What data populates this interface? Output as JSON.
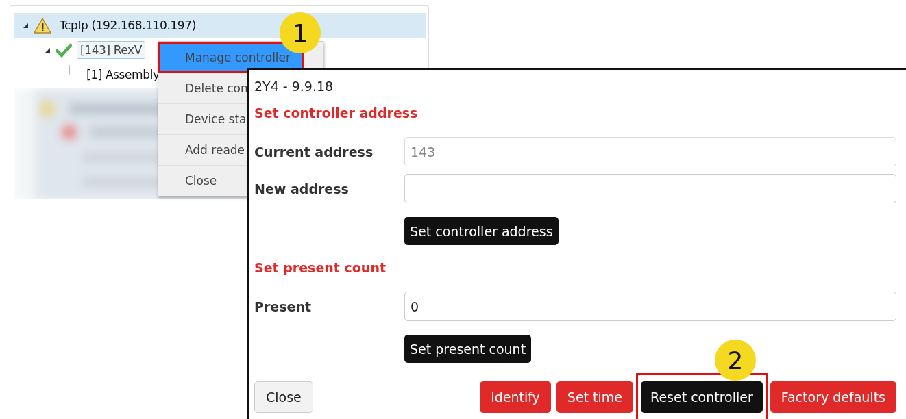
{
  "tree": {
    "items": [
      {
        "label": "TcpIp (192.168.110.197)",
        "kind": "warning",
        "expanded": true,
        "selected": true,
        "focused": false,
        "children": [
          {
            "label": "[143] RexV",
            "kind": "ok",
            "expanded": true,
            "selected": false,
            "focused": true,
            "children": [
              {
                "label": "[1] Assembly",
                "selected": false,
                "focused": false
              }
            ]
          }
        ]
      }
    ]
  },
  "context_menu": {
    "items": [
      {
        "label": "Manage controller",
        "highlighted": true,
        "callout": true
      },
      {
        "label": "Delete con",
        "highlighted": false,
        "callout": false
      },
      {
        "label": "Device sta",
        "highlighted": false,
        "callout": false
      },
      {
        "label": "Add reade",
        "highlighted": false,
        "callout": false
      },
      {
        "label": "Close",
        "highlighted": false,
        "callout": false
      }
    ]
  },
  "dialog": {
    "title": "2Y4 - 9.9.18",
    "sections": [
      {
        "heading": "Set controller address",
        "fields": [
          {
            "label": "Current address",
            "value": "143",
            "disabled": true
          },
          {
            "label": "New address",
            "disabled": false
          }
        ],
        "button": "Set controller address"
      },
      {
        "heading": "Set present count",
        "fields": [
          {
            "label": "Present",
            "value": "0",
            "disabled": false
          }
        ],
        "button": "Set present count"
      }
    ],
    "footer_buttons": [
      {
        "label": "Close",
        "kind": "default",
        "callout": false
      },
      {
        "label": "Identify",
        "kind": "danger",
        "callout": false
      },
      {
        "label": "Set time",
        "kind": "danger",
        "callout": false
      },
      {
        "label": "Reset controller",
        "kind": "dark",
        "callout": true
      },
      {
        "label": "Factory defaults",
        "kind": "danger",
        "callout": false
      }
    ]
  },
  "callouts": [
    {
      "label": "1"
    },
    {
      "label": "2"
    }
  ]
}
